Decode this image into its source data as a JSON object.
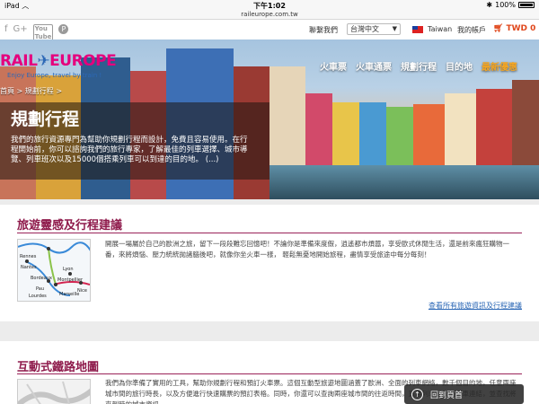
{
  "statusbar": {
    "device": "iPad",
    "wifi_icon": "wifi-icon",
    "time": "下午1:02",
    "battery": "100%"
  },
  "url": "raileurope.com.tw",
  "topbar": {
    "social": [
      "facebook-icon",
      "google-plus-icon",
      "youtube-icon",
      "pinterest-icon"
    ],
    "contact": "聯繫我們",
    "language": "台灣中文",
    "country": "Taiwan",
    "account": "我的帳戶",
    "cart_label": "TWD 0"
  },
  "logo": {
    "brand_left": "RAIL",
    "brand_mid": "✈",
    "brand_right": "EUROPE",
    "tagline": "Enjoy Europe, travel by train !"
  },
  "nav": [
    "火車票",
    "火車通票",
    "規劃行程",
    "目的地",
    "最新優惠"
  ],
  "breadcrumb": "首頁 > 規劃行程 >",
  "hero": {
    "title": "規劃行程",
    "description": "我們的旅行資源專門為幫助你規劃行程而設計，免費且容易使用。在行程開始前，你可以諮詢我們的旅行專家，了解最佳的列車選擇、城市導覽、列車班次以及15000個搭乘列車可以到達的目的地。 (...)"
  },
  "section1": {
    "title": "旅遊靈感及行程建議",
    "text": "開展一場屬於自己的歐洲之旅，留下一段段難忘回憶吧！不論你是準備來度假，逍遙都市煩囂，享受歐式休閒生活，還是前來瘋狂購物一番，來將煩惱、壓力統統拋諸腦後吧，就像你坐火車一樣， 輕鬆無憂地開始旅程，盡情享受旅途中每分每刻！",
    "link": "查看所有旅遊資訊及行程建議",
    "map_labels": [
      "Rennes",
      "Nantes",
      "Lyon",
      "Bordeaux",
      "Nice",
      "Pau",
      "Lourdes",
      "Montpellier",
      "Marseille"
    ]
  },
  "section2": {
    "title": "互動式鐵路地圖",
    "text": "我們為你準備了實用的工具，幫助你規劃行程和預訂火車票。這個互動型旅遊地圖涵蓋了歐洲、全面的列車網絡，數千個目的地，任意兩座城市間的旅行時長，以及方便進行快速購票的預訂表格。同時，你還可以查詢兩座城市間的往返時間，直通列車或夜間列車連結，並查找將來到時的城市資訊。"
  },
  "totop": "回到頁首"
}
